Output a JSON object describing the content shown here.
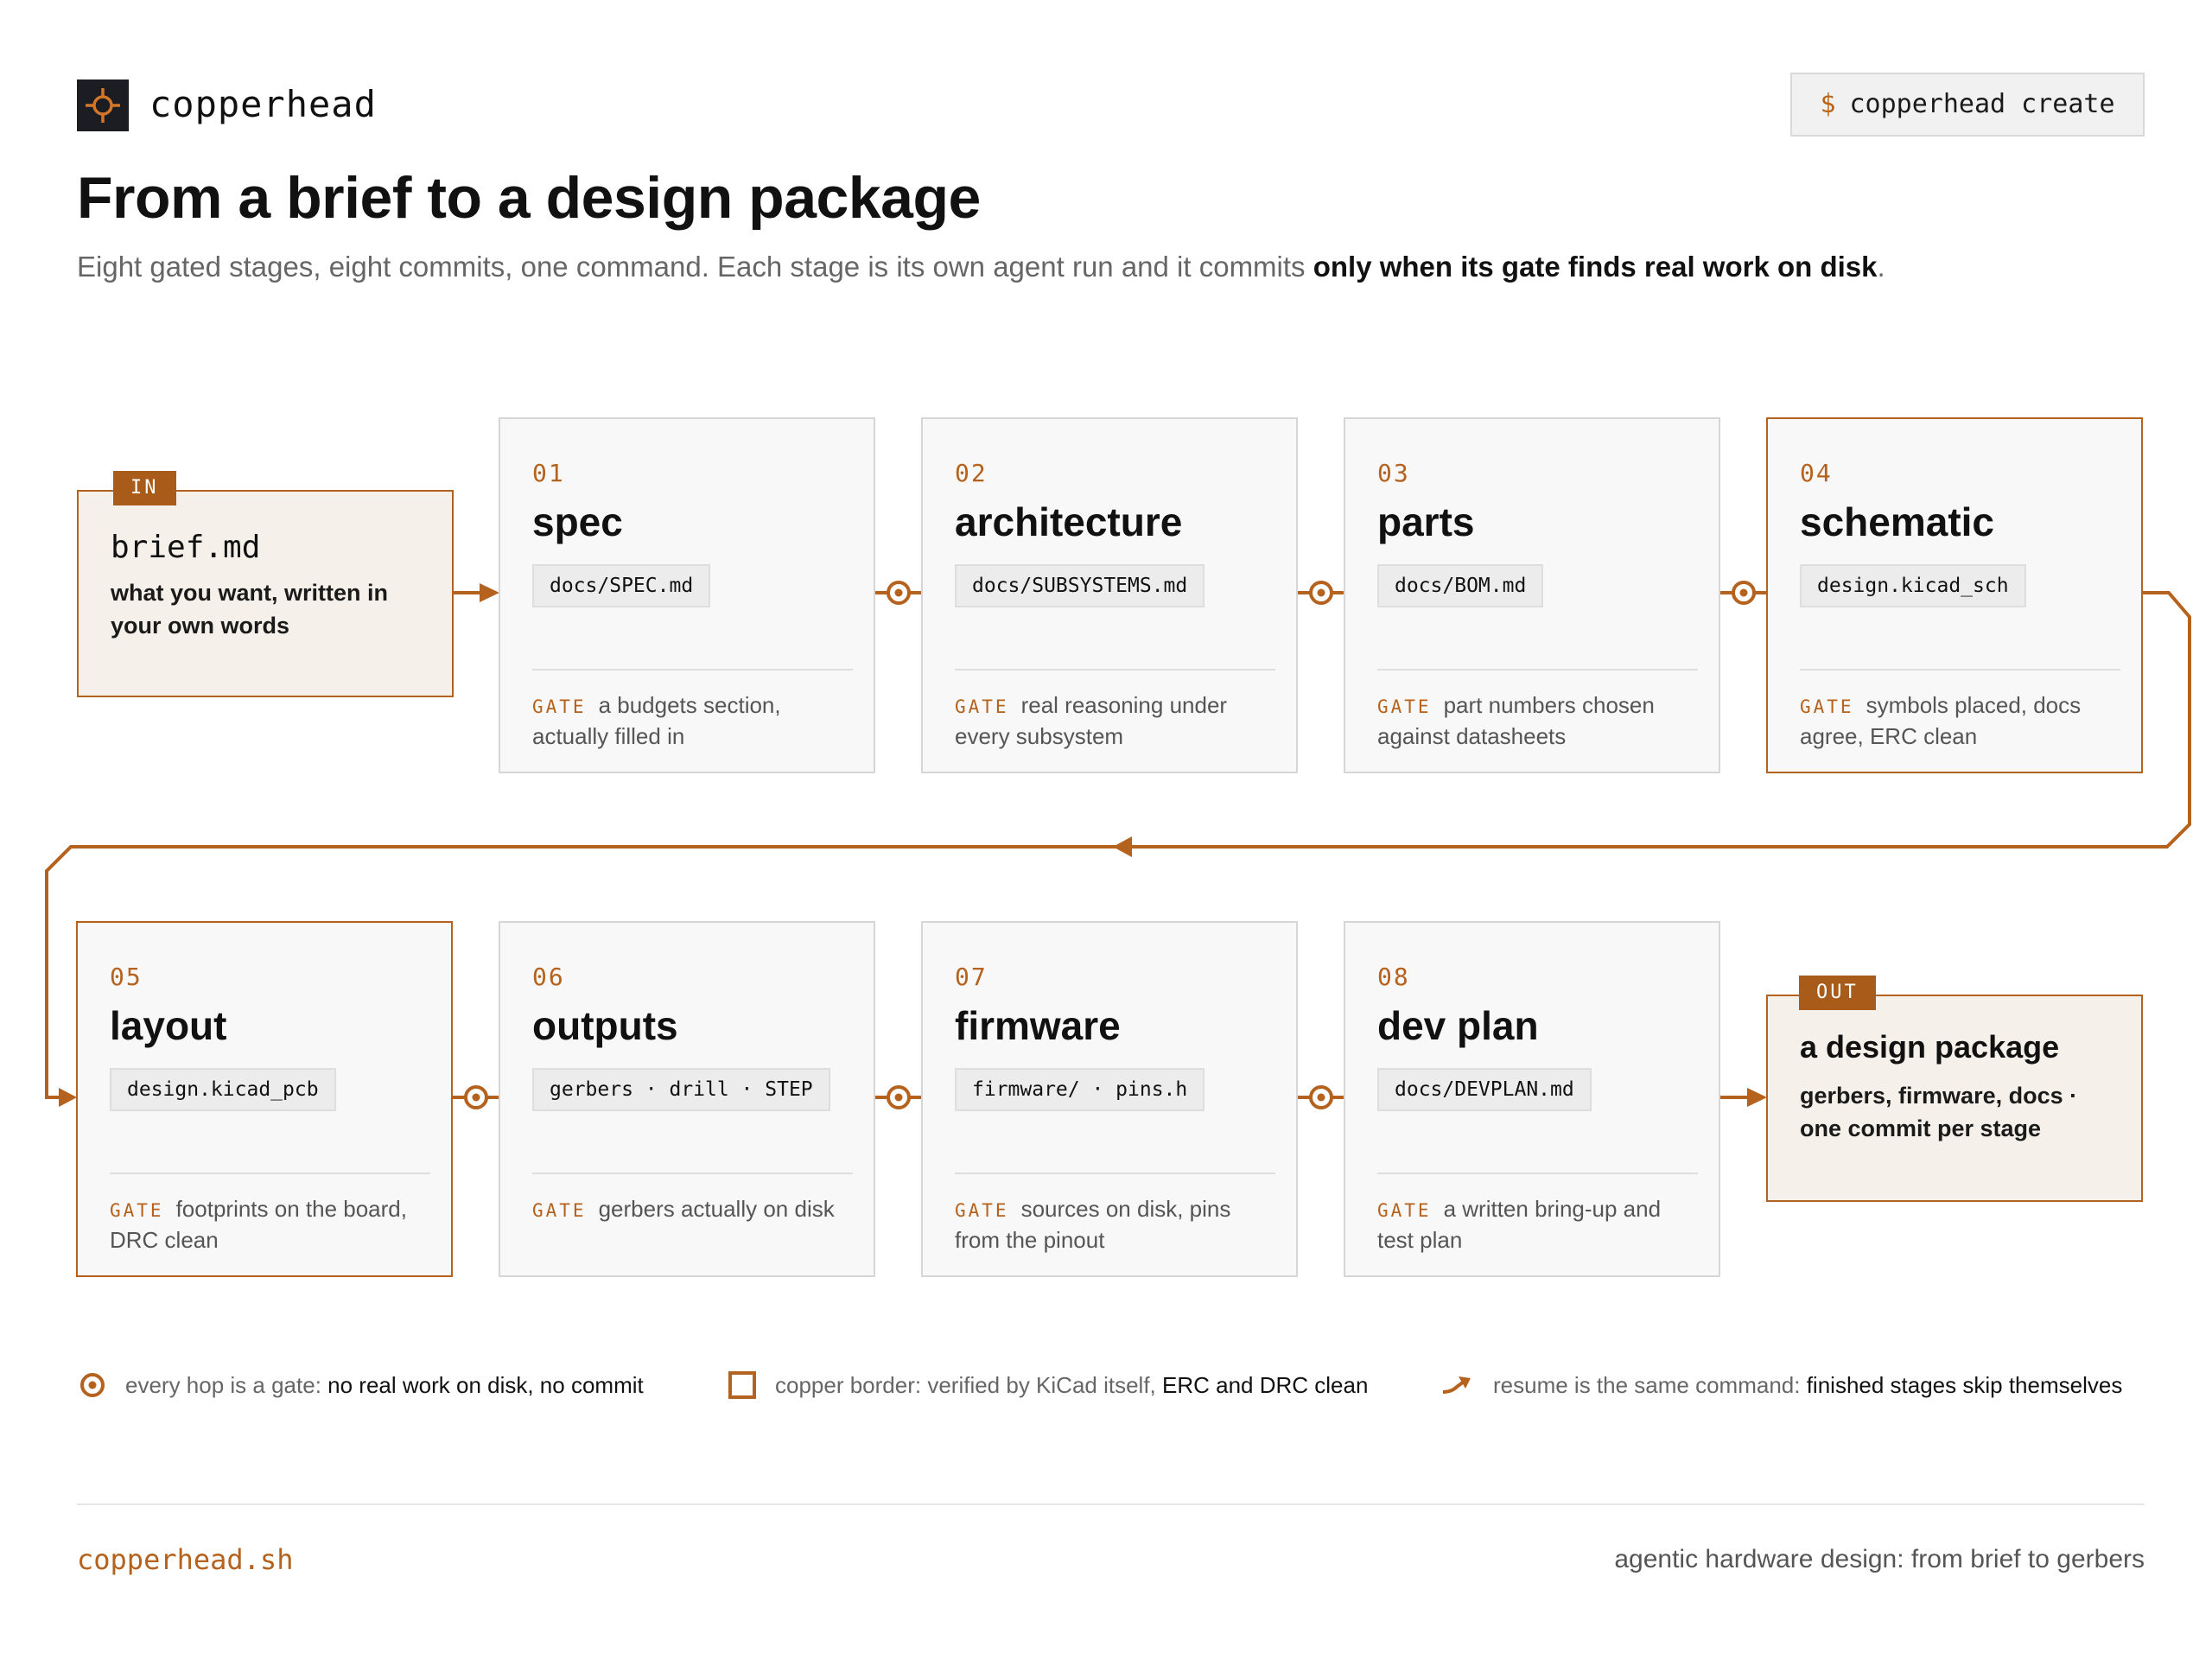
{
  "header": {
    "brand": "copperhead",
    "command_prompt": "$",
    "command": "copperhead create",
    "title": "From a brief to a design package",
    "subtitle_plain": "Eight gated stages, eight commits, one command. Each stage is its own agent run and it commits ",
    "subtitle_bold": "only when its gate finds real work on disk",
    "subtitle_end": "."
  },
  "input": {
    "tag": "IN",
    "title": "brief.md",
    "desc": "what you want, written in your own words"
  },
  "output": {
    "tag": "OUT",
    "title": "a design package",
    "desc": "gerbers, firmware, docs · one commit per stage"
  },
  "gate_label": "GATE",
  "stages": [
    {
      "num": "01",
      "name": "spec",
      "file": "docs/SPEC.md",
      "gate": "a budgets section, actually filled in"
    },
    {
      "num": "02",
      "name": "architecture",
      "file": "docs/SUBSYSTEMS.md",
      "gate": "real reasoning under every subsystem"
    },
    {
      "num": "03",
      "name": "parts",
      "file": "docs/BOM.md",
      "gate": "part numbers chosen against datasheets"
    },
    {
      "num": "04",
      "name": "schematic",
      "file": "design.kicad_sch",
      "gate": "symbols placed, docs agree, ERC clean"
    },
    {
      "num": "05",
      "name": "layout",
      "file": "design.kicad_pcb",
      "gate": "footprints on the board, DRC clean"
    },
    {
      "num": "06",
      "name": "outputs",
      "file": "gerbers · drill · STEP",
      "gate": "gerbers actually on disk"
    },
    {
      "num": "07",
      "name": "firmware",
      "file": "firmware/ · pins.h",
      "gate": "sources on disk, pins from the pinout"
    },
    {
      "num": "08",
      "name": "dev plan",
      "file": "docs/DEVPLAN.md",
      "gate": "a written bring-up and test plan"
    }
  ],
  "legend": [
    {
      "icon": "gate-hop-icon",
      "plain": "every hop is a gate: ",
      "bold": "no real work on disk, no commit"
    },
    {
      "icon": "copper-square-icon",
      "plain": "copper border: verified by KiCad itself, ",
      "bold": "ERC and DRC clean"
    },
    {
      "icon": "resume-arrow-icon",
      "plain": "resume is the same command: ",
      "bold": "finished stages skip themselves"
    }
  ],
  "footer": {
    "site": "copperhead.sh",
    "tagline": "agentic hardware design: from brief to gerbers"
  },
  "colors": {
    "copper": "#b4621d",
    "card_bg": "#f8f8f8",
    "io_bg": "#f5f0e9",
    "logo_bg": "#1b1d22"
  }
}
